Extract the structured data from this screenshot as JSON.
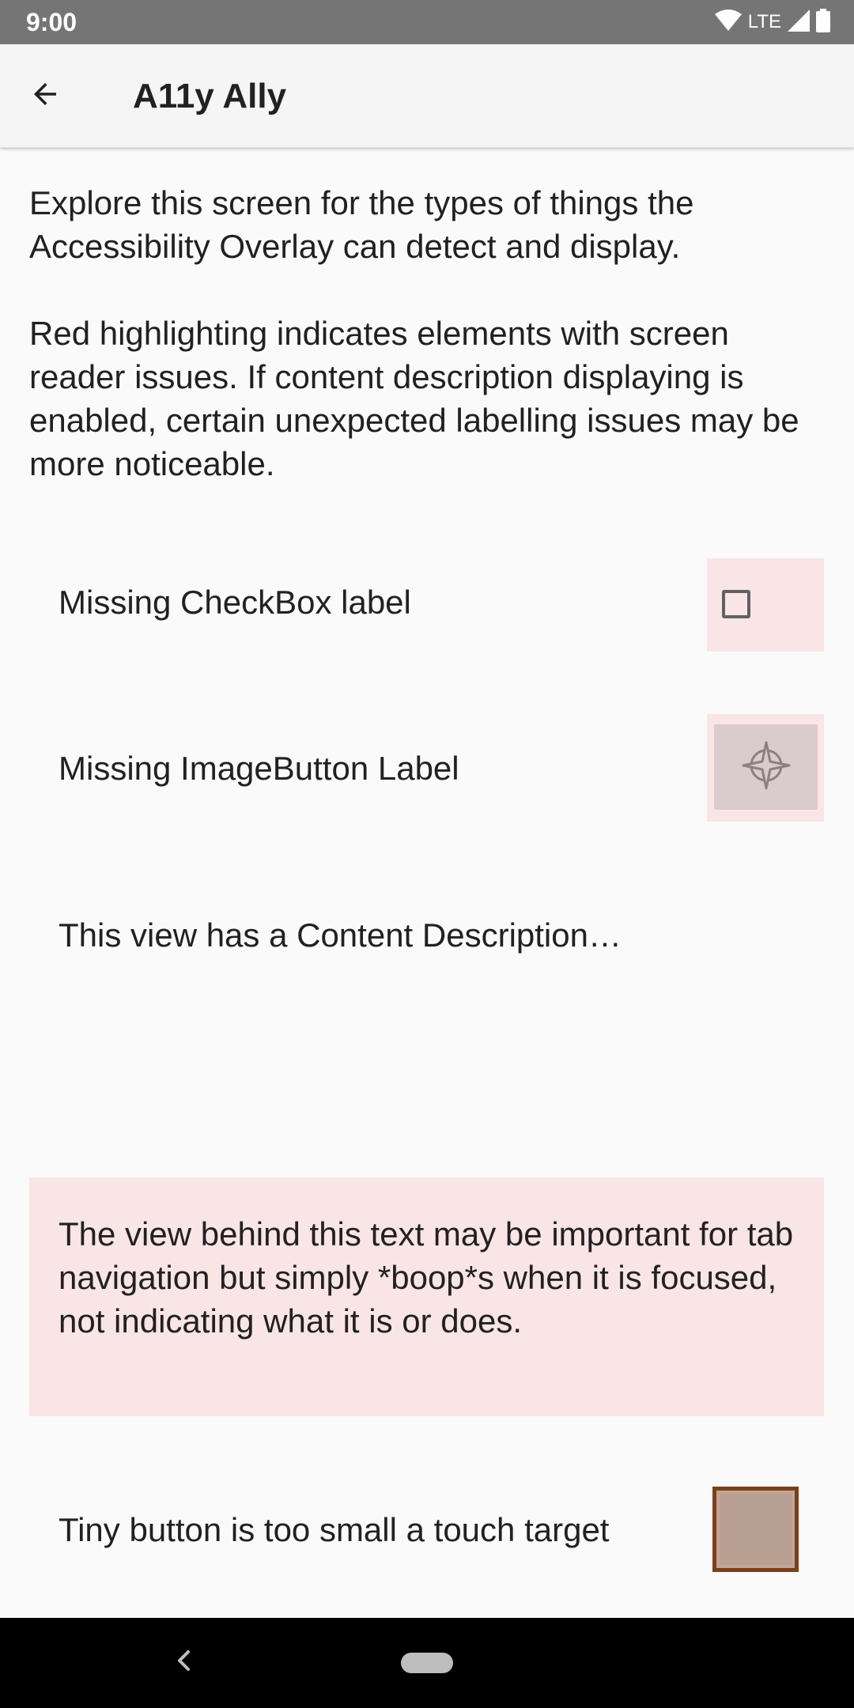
{
  "status_bar": {
    "time": "9:00",
    "network": "LTE",
    "icons": [
      "wifi-icon",
      "signal-icon",
      "battery-icon"
    ]
  },
  "app_bar": {
    "title": "A11y Ally",
    "back_icon": "arrow-back-icon"
  },
  "intro": {
    "paragraph1": "Explore this screen for the types of things the Accessibility Overlay can detect and display.",
    "paragraph2": "Red highlighting indicates elements with screen reader issues. If content description displaying is enabled, certain unexpected labelling issues may be more noticeable."
  },
  "rows": {
    "checkbox_label": "Missing CheckBox label",
    "checkbox_checked": false,
    "imagebutton_label": "Missing ImageButton Label",
    "imagebutton_icon": "compass-icon",
    "content_description_label": "This view has a Content Description…",
    "boop_text": "The view behind this text may be important for tab navigation but simply *boop*s when it is focused, not indicating what it is or does.",
    "tiny_button_label": "Tiny button is too small a touch target"
  },
  "colors": {
    "status_bar": "#757575",
    "app_bar": "#f5f5f5",
    "highlight": "#f9e5e6",
    "tiny_button_border": "#7a4119",
    "tiny_button_fill": "#c3a595",
    "nav_bar": "#000000"
  },
  "nav_bar": {
    "icons": [
      "nav-back-icon",
      "nav-home-pill"
    ]
  }
}
